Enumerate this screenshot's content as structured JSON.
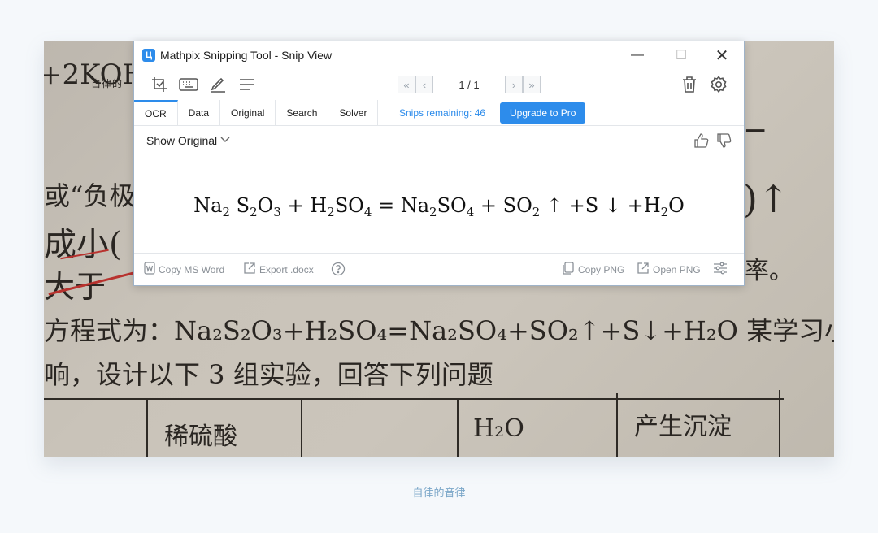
{
  "background": {
    "top_text": "+2KOH",
    "small_text": "自律的",
    "left_lines": [
      "或“负极",
      "成小(",
      "大于"
    ],
    "right_lines": [
      "−",
      ")↑",
      "率。"
    ],
    "equation_line": "方程式为：Na₂S₂O₃+H₂SO₄=Na₂SO₄+SO₂↑+S↓+H₂O 某学习小组为",
    "line5": "响，设计以下 3 组实验，回答下列问题",
    "table_cells": [
      "稀硫酸",
      "H₂O",
      "产生沉淀"
    ]
  },
  "window": {
    "title": "Mathpix Snipping Tool - Snip View",
    "logo": "Ц",
    "controls": {
      "minimize": "—",
      "maximize": "☐",
      "close": "✕"
    }
  },
  "toolbar": {
    "icons": [
      "crop-icon",
      "keyboard-icon",
      "pen-icon",
      "menu-icon",
      "trash-icon",
      "gear-icon"
    ],
    "pager": {
      "first": "«",
      "prev": "‹",
      "label": "1 / 1",
      "next": "›",
      "last": "»"
    }
  },
  "tabs": [
    {
      "label": "OCR",
      "active": true
    },
    {
      "label": "Data",
      "active": false
    },
    {
      "label": "Original",
      "active": false
    },
    {
      "label": "Search",
      "active": false
    },
    {
      "label": "Solver",
      "active": false
    }
  ],
  "snips_remaining": "Snips remaining: 46",
  "upgrade_label": "Upgrade to Pro",
  "content": {
    "show_original": "Show Original",
    "formula": {
      "p1": "Na",
      "s1": "2",
      "p2": " S",
      "s2": "2",
      "p3": "O",
      "s3": "3",
      "p4": " + H",
      "s4": "2",
      "p5": "SO",
      "s5": "4",
      "p6": " = Na",
      "s6": "2",
      "p7": "SO",
      "s7": "4",
      "p8": " + SO",
      "s8": "2",
      "p9": " ↑ +S ↓ +H",
      "s9": "2",
      "p10": "O"
    }
  },
  "footer": {
    "copy_word": "Copy MS Word",
    "export_docx": "Export .docx",
    "copy_png": "Copy PNG",
    "open_png": "Open PNG"
  },
  "caption": "自律的音律",
  "colors": {
    "accent": "#2d8ceb",
    "caption": "#7aa6c8"
  }
}
